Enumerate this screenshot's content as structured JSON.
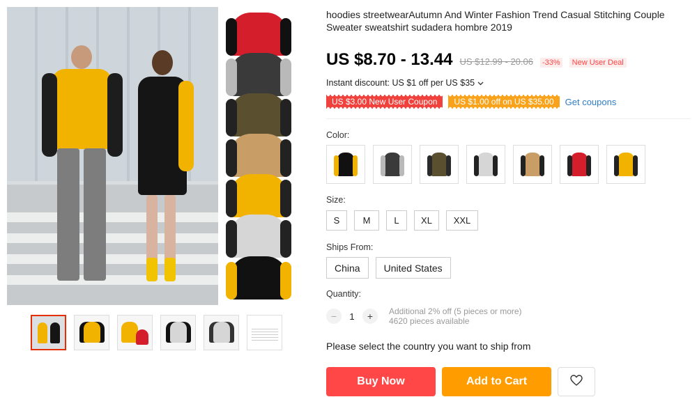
{
  "product": {
    "title": "hoodies streetwearAutumn And Winter Fashion Trend Casual Stitching Couple Sweater sweatshirt sudadera hombre 2019",
    "price": "US $8.70 - 13.44",
    "original_price": "US $12.99 - 20.06",
    "discount": "-33%",
    "deal_label": "New User Deal",
    "instant_discount": "Instant discount: US $1 off per US $35",
    "coupons": [
      {
        "label": "US $3.00 New User Coupon",
        "color": "#f0413d"
      },
      {
        "label": "US $1.00 off on US $35.00",
        "color": "#f8a31b"
      }
    ],
    "get_coupons_label": "Get coupons"
  },
  "color": {
    "label": "Color:",
    "options": [
      {
        "body": "#111111",
        "sleeve": "#f2b300"
      },
      {
        "body": "#3a3a3a",
        "sleeve": "#b9b9b9"
      },
      {
        "body": "#5a5030",
        "sleeve": "#2a2a2a"
      },
      {
        "body": "#d6d6d6",
        "sleeve": "#222222"
      },
      {
        "body": "#c89e66",
        "sleeve": "#222222"
      },
      {
        "body": "#d51e2b",
        "sleeve": "#222222"
      },
      {
        "body": "#f2b300",
        "sleeve": "#222222"
      }
    ]
  },
  "size": {
    "label": "Size:",
    "options": [
      "S",
      "M",
      "L",
      "XL",
      "XXL"
    ]
  },
  "ships_from": {
    "label": "Ships From:",
    "options": [
      "China",
      "United States"
    ]
  },
  "quantity": {
    "label": "Quantity:",
    "minus": "−",
    "value": "1",
    "plus": "+",
    "info_line1": "Additional 2% off (5 pieces or more)",
    "info_line2": "4620 pieces available"
  },
  "ship_note": "Please select the country you want to ship from",
  "actions": {
    "buy_now": "Buy Now",
    "add_to_cart": "Add to Cart"
  },
  "colors": {
    "accent_red": "#ff4747",
    "accent_orange": "#ff9c00",
    "link_blue": "#2e7dc7"
  }
}
